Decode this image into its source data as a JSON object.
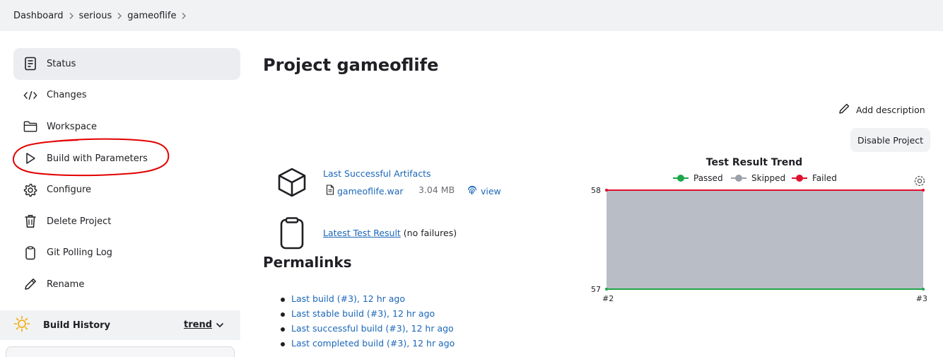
{
  "breadcrumb": {
    "items": [
      "Dashboard",
      "serious",
      "gameoflife"
    ]
  },
  "sidebar": {
    "items": [
      {
        "label": "Status",
        "icon": "document-icon",
        "active": true
      },
      {
        "label": "Changes",
        "icon": "code-icon"
      },
      {
        "label": "Workspace",
        "icon": "folder-icon"
      },
      {
        "label": "Build with Parameters",
        "icon": "play-icon"
      },
      {
        "label": "Configure",
        "icon": "gear-icon"
      },
      {
        "label": "Delete Project",
        "icon": "trash-icon"
      },
      {
        "label": "Git Polling Log",
        "icon": "clipboard-icon"
      },
      {
        "label": "Rename",
        "icon": "pencil-icon"
      }
    ],
    "history": {
      "title": "Build History",
      "trend_label": "trend",
      "icon": "sun-icon"
    }
  },
  "main": {
    "title": "Project gameoflife",
    "add_description": "Add description",
    "disable_button": "Disable Project",
    "artifacts": {
      "title": "Last Successful Artifacts",
      "file_name": "gameoflife.war",
      "file_size": "3.04 MB",
      "view_label": "view"
    },
    "test_result": {
      "link": "Latest Test Result",
      "note": " (no failures)"
    },
    "permalinks": {
      "title": "Permalinks",
      "items": [
        "Last build (#3), 12 hr ago",
        "Last stable build (#3), 12 hr ago",
        "Last successful build (#3), 12 hr ago",
        "Last completed build (#3), 12 hr ago"
      ]
    }
  },
  "chart_data": {
    "type": "area",
    "title": "Test Result Trend",
    "categories": [
      "#2",
      "#3"
    ],
    "series": [
      {
        "name": "Passed",
        "values": [
          57,
          57
        ],
        "color": "#1ea64a"
      },
      {
        "name": "Skipped",
        "values": [
          1,
          1
        ],
        "color": "#9ba1aa"
      },
      {
        "name": "Failed",
        "values": [
          0,
          0
        ],
        "color": "#e0102f"
      }
    ],
    "ylim": [
      57,
      58
    ],
    "yticks": [
      "57",
      "58"
    ],
    "legend": "top",
    "stacked": true
  },
  "colors": {
    "link": "#1b66b8",
    "annotation": "#e30000",
    "skipped_fill": "#b9bec6"
  }
}
